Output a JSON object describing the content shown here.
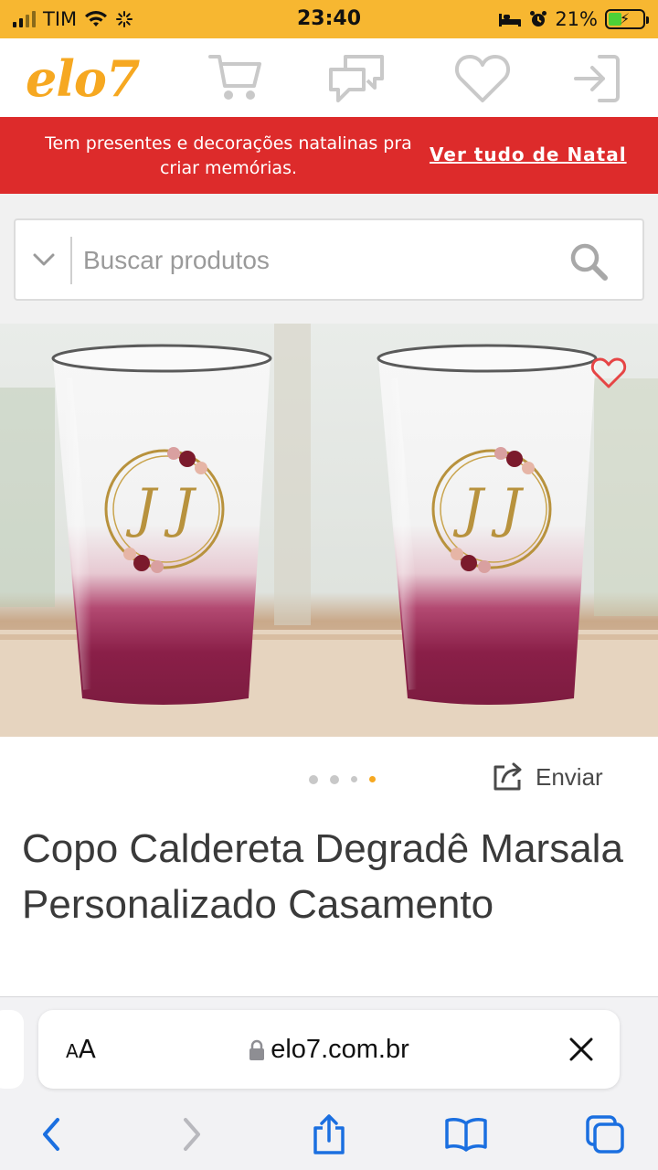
{
  "status_bar": {
    "carrier": "TIM",
    "time": "23:40",
    "battery_percent": "21%",
    "signal_bars": 2,
    "battery_level": 0.21
  },
  "header": {
    "logo": "elo7",
    "icons": [
      "cart-icon",
      "chat-icon",
      "heart-icon",
      "login-icon"
    ]
  },
  "promo": {
    "text": "Tem presentes e decorações natalinas pra criar memórias.",
    "link": "Ver tudo de Natal"
  },
  "search": {
    "placeholder": "Buscar produtos"
  },
  "product": {
    "title": "Copo Caldereta Degradê Marsala Personalizado Casamento",
    "image_monogram": "J J",
    "gallery_count": 4,
    "gallery_active_index": 3,
    "share_label": "Enviar"
  },
  "browser": {
    "text_size_label_small": "A",
    "text_size_label_large": "A",
    "url": "elo7.com.br"
  },
  "colors": {
    "status_bar": "#f7b731",
    "brand": "#f6a821",
    "promo_bg": "#dd2b2b",
    "safari_accent": "#1b6fe0",
    "marsala": "#7d1c40"
  }
}
